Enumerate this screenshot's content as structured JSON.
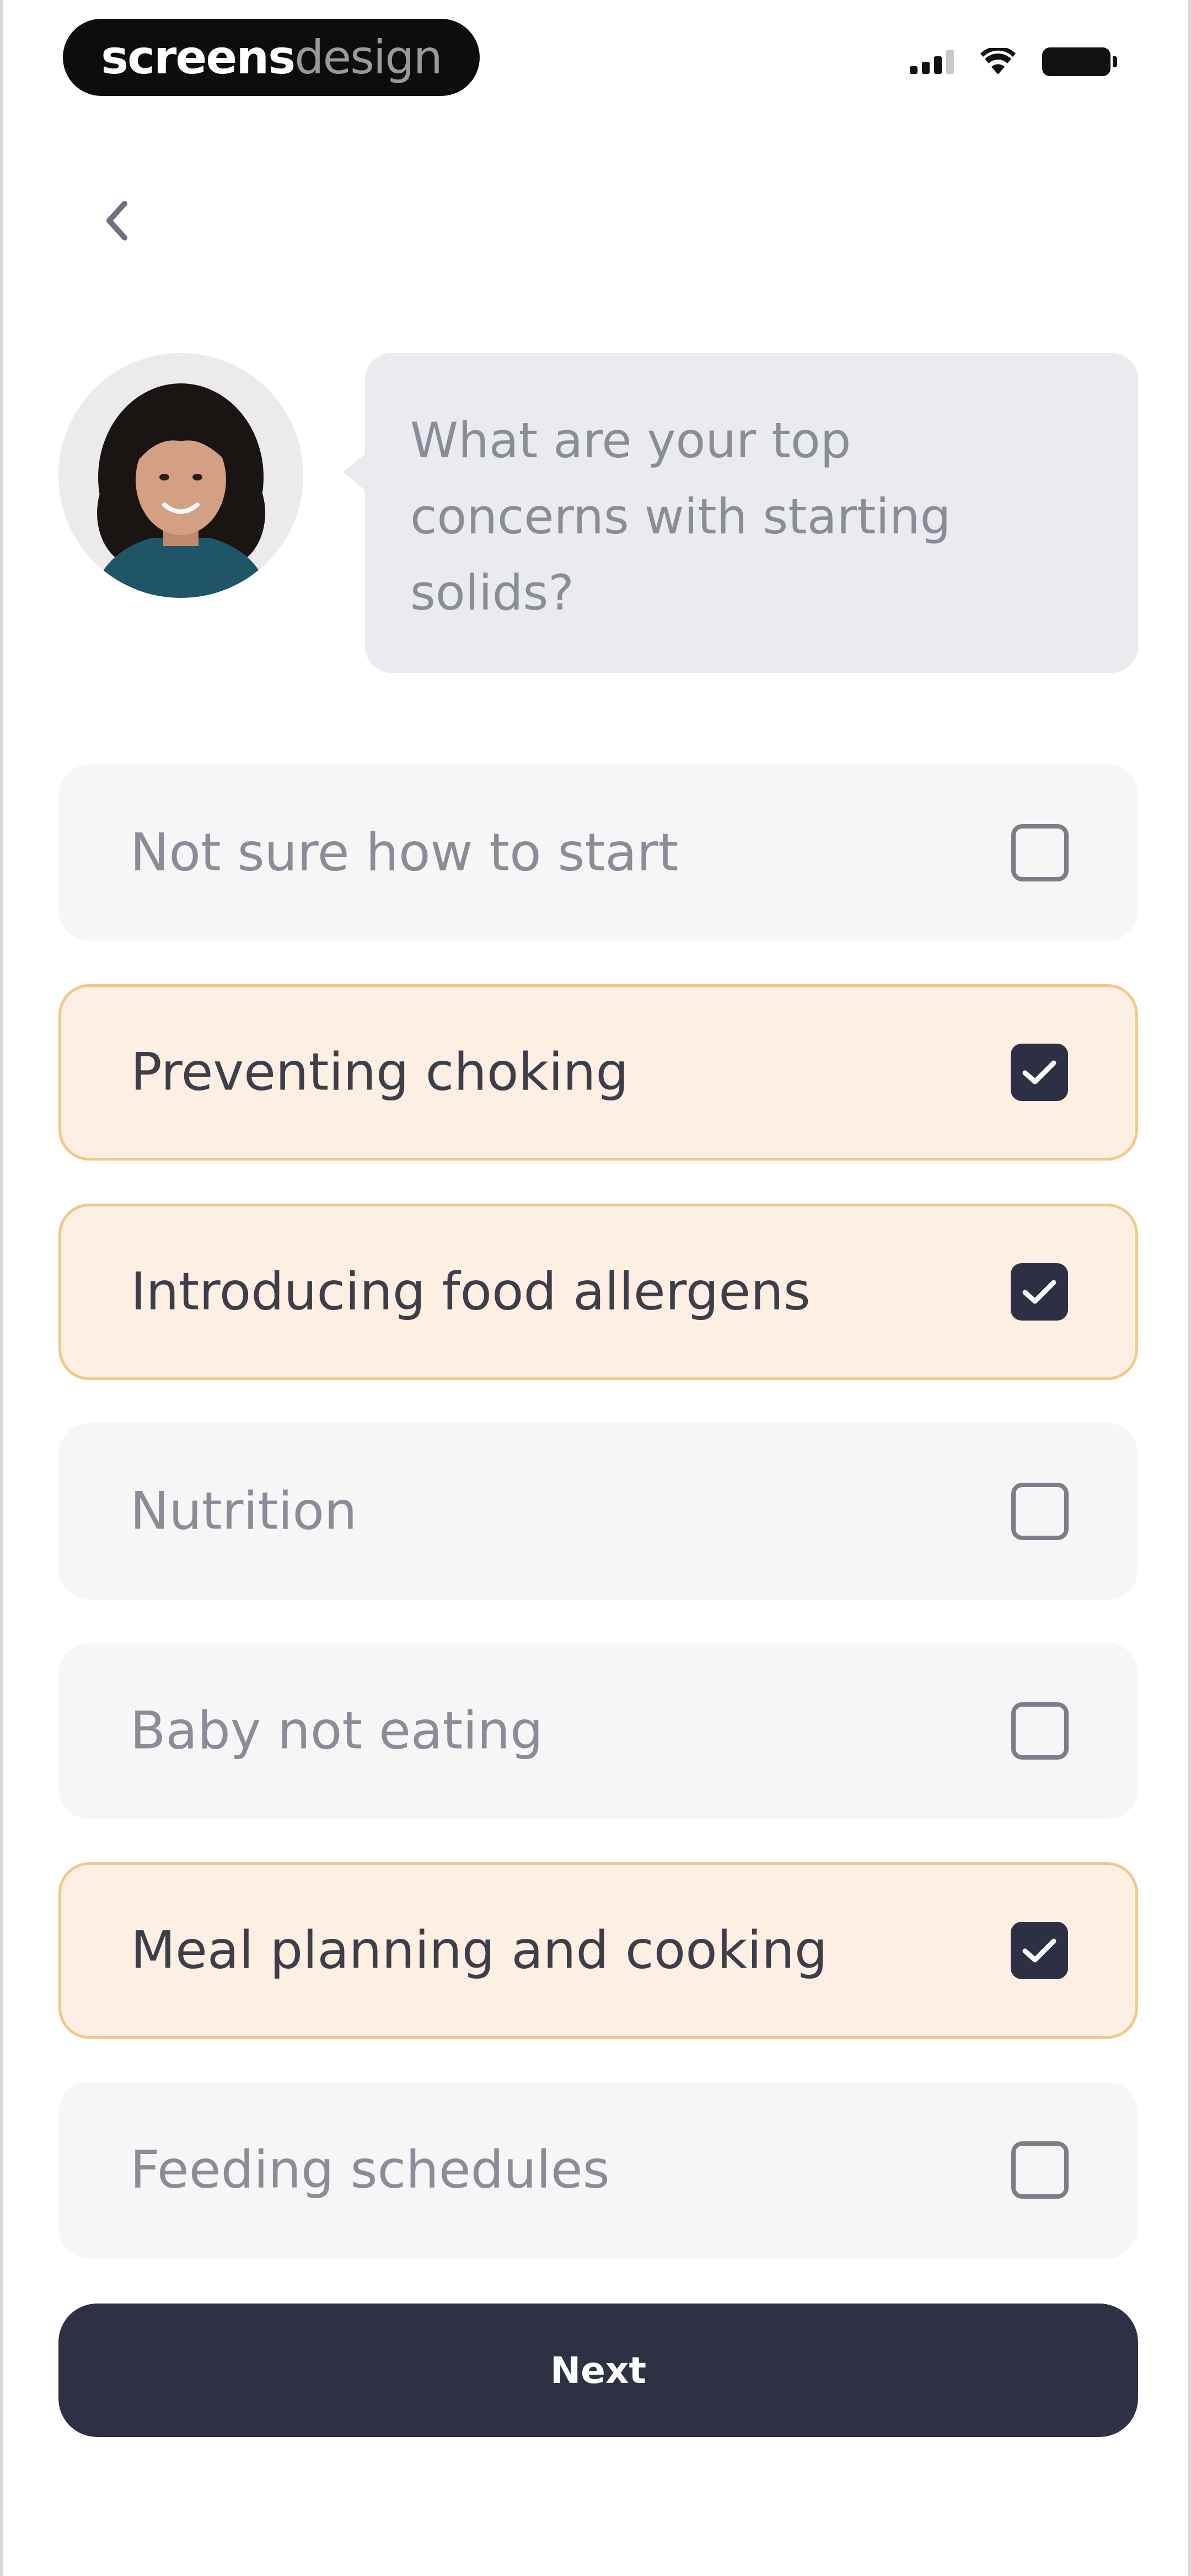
{
  "status_bar": {
    "brand_bold": "screens",
    "brand_light": "design",
    "icons": [
      "cellular-signal-icon",
      "wifi-icon",
      "battery-icon"
    ]
  },
  "nav": {
    "back_icon": "chevron-left-icon"
  },
  "prompt": {
    "question": "What are your top concerns with starting solids?"
  },
  "options": [
    {
      "label": "Not sure how to start",
      "checked": false
    },
    {
      "label": "Preventing choking",
      "checked": true
    },
    {
      "label": "Introducing food allergens",
      "checked": true
    },
    {
      "label": "Nutrition",
      "checked": false
    },
    {
      "label": "Baby not eating",
      "checked": false
    },
    {
      "label": "Meal planning and cooking",
      "checked": true
    },
    {
      "label": "Feeding schedules",
      "checked": false
    }
  ],
  "actions": {
    "next_label": "Next"
  },
  "colors": {
    "selected_fill": "#fdefe3",
    "selected_border": "#f1c88b",
    "unselected_fill": "#f6f6f7",
    "primary_dark": "#2e3143",
    "bubble_fill": "#e9ebee"
  }
}
